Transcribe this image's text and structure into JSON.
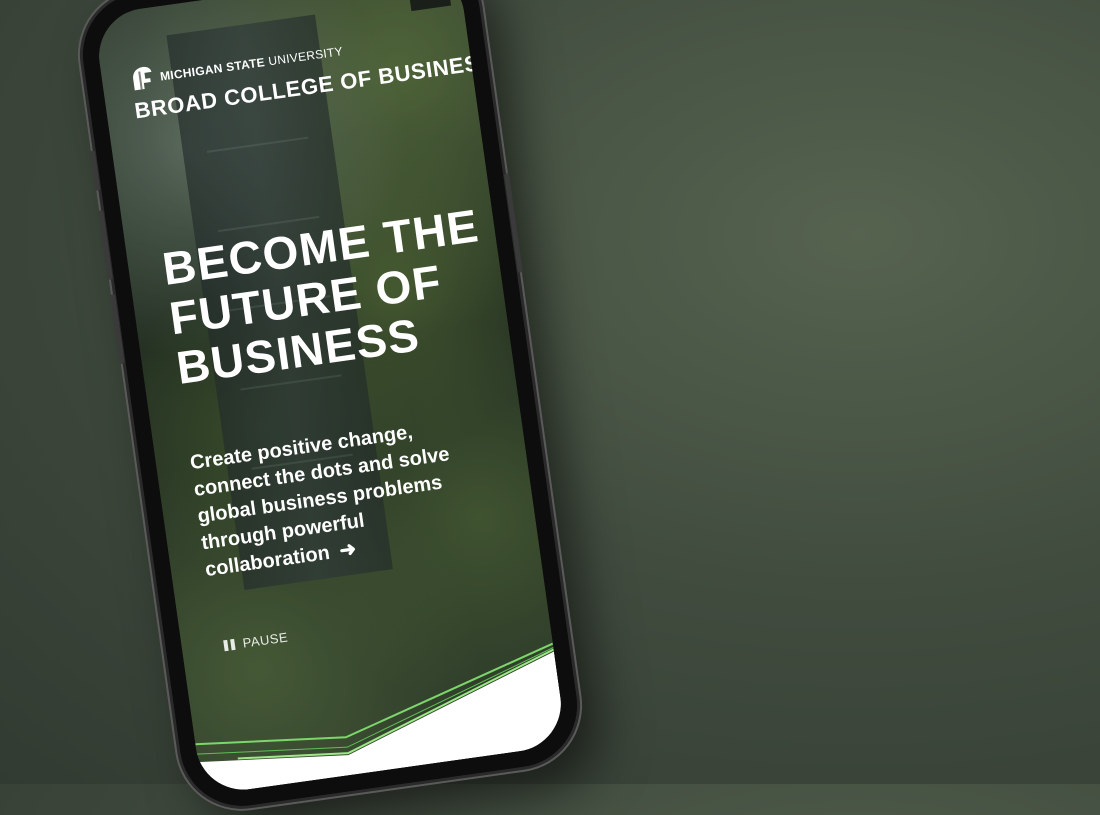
{
  "header": {
    "menu_icon": "hamburger-icon",
    "logo_icon": "spartan-helmet-icon",
    "university_bold": "MICHIGAN STATE",
    "university_light": "UNIVERSITY",
    "college": "BROAD COLLEGE OF BUSINESS"
  },
  "hero": {
    "headline": [
      "BECOME THE",
      "FUTURE OF",
      "BUSINESS"
    ],
    "subtext": [
      "Create positive change,",
      "connect the dots and solve",
      "global business problems",
      "through powerful",
      "collaboration"
    ],
    "cta_icon": "arrow-right-icon"
  },
  "controls": {
    "pause_label": "PAUSE",
    "pause_icon": "pause-icon"
  },
  "colors": {
    "accent_green": "#7cd66b",
    "menu_bg": "#1a1f1a",
    "page_bg": "#414c3f"
  }
}
